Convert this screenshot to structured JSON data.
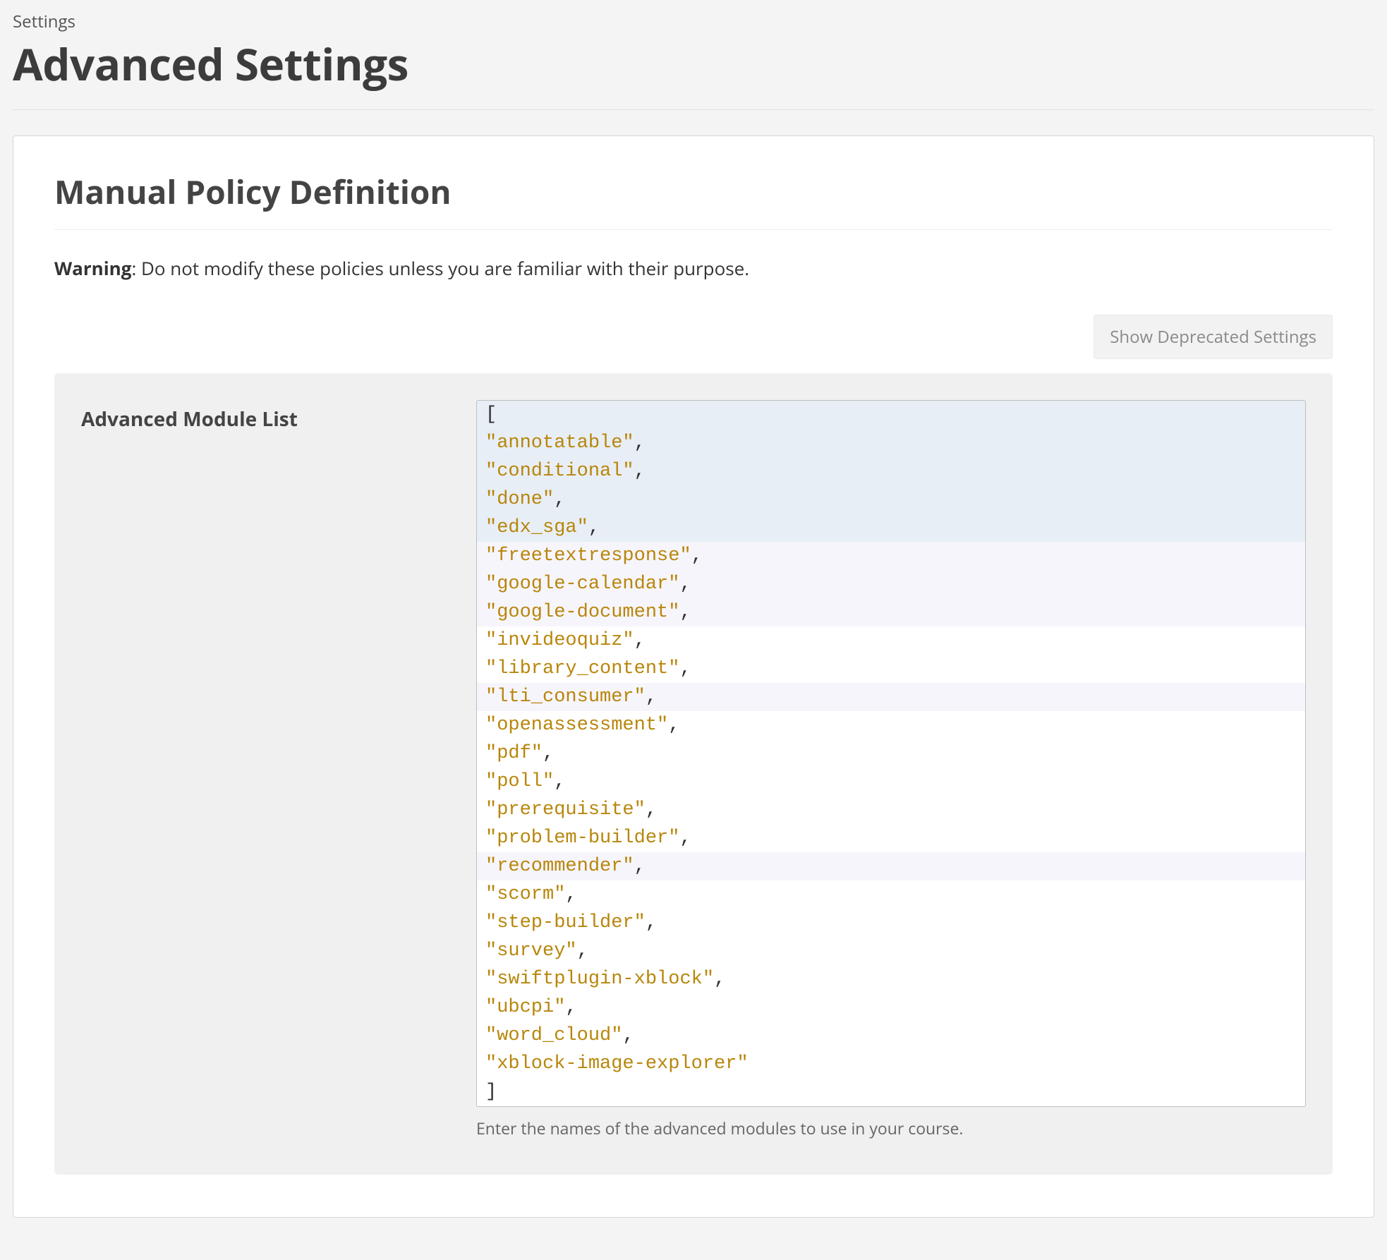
{
  "header": {
    "breadcrumb": "Settings",
    "title": "Advanced Settings"
  },
  "panel": {
    "title": "Manual Policy Definition",
    "warning_label": "Warning",
    "warning_text": ": Do not modify these policies unless you are familiar with their purpose.",
    "deprecated_button": "Show Deprecated Settings"
  },
  "setting": {
    "label": "Advanced Module List",
    "hint": "Enter the names of the advanced modules to use in your course.",
    "modules": [
      "annotatable",
      "conditional",
      "done",
      "edx_sga",
      "freetextresponse",
      "google-calendar",
      "google-document",
      "invideoquiz",
      "library_content",
      "lti_consumer",
      "openassessment",
      "pdf",
      "poll",
      "prerequisite",
      "problem-builder",
      "recommender",
      "scorm",
      "step-builder",
      "survey",
      "swiftplugin-xblock",
      "ubcpi",
      "word_cloud",
      "xblock-image-explorer"
    ],
    "active_line_count": 5,
    "var_line_indices": [
      5,
      6,
      7,
      10,
      16
    ]
  }
}
